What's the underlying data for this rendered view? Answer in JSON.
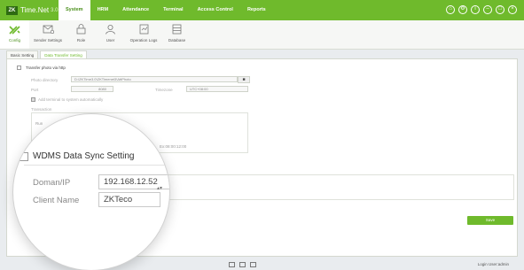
{
  "app": {
    "logo": "ZK",
    "title": "Time.Net",
    "version": "3.0"
  },
  "menu": [
    "System",
    "HRM",
    "Attendance",
    "Terminal",
    "Access Control",
    "Reports"
  ],
  "menu_active_index": 0,
  "window_controls": [
    "home-icon",
    "settings-icon",
    "info-icon",
    "minimize-icon",
    "maximize-icon",
    "close-icon"
  ],
  "toolbar": [
    {
      "label": "Config",
      "icon": "tools-icon"
    },
    {
      "label": "Sender Settings",
      "icon": "sender-icon"
    },
    {
      "label": "Role",
      "icon": "role-icon"
    },
    {
      "label": "User",
      "icon": "user-icon"
    },
    {
      "label": "Operation Logs",
      "icon": "logs-icon"
    },
    {
      "label": "Database",
      "icon": "database-icon"
    }
  ],
  "subtabs": [
    "Basic Setting",
    "Data Transfer Setting"
  ],
  "transfer": {
    "checkbox_label": "Transfer photo via http",
    "photo_dir_label": "Photo directory",
    "photo_dir_value": "D:\\ZKTime3.0\\ZKTimenet3\\AttPhoto",
    "port_label": "Port",
    "port_value": "8080",
    "timezone_label": "Timezone",
    "timezone_value": "UTC+08:00",
    "add_terminal_label": "Add terminal to system automatically",
    "transaction_label": "Transaction",
    "run_label": "Run",
    "time_value": "Ex:08:00:12:00"
  },
  "wdms": {
    "title": "WDMS Data Sync Setting",
    "domain_label": "Doman/IP",
    "domain_value": "192.168.12.52",
    "client_label": "Client Name",
    "client_value": "ZKTeco"
  },
  "save_label": "Save",
  "status": {
    "login": "Login User:admin"
  },
  "colors": {
    "accent": "#6fba2c",
    "accent_dark": "#4a8f1a"
  }
}
